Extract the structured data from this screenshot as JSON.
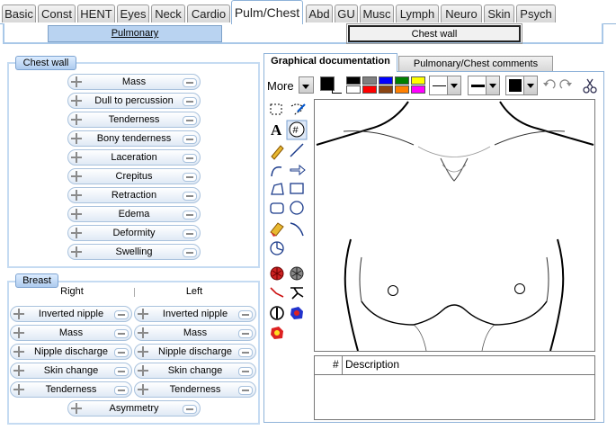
{
  "tabs": [
    "Basic",
    "Const",
    "HENT",
    "Eyes",
    "Neck",
    "Cardio",
    "Pulm/Chest",
    "Abd",
    "GU",
    "Musc",
    "Lymph",
    "Neuro",
    "Skin",
    "Psych"
  ],
  "subtabs": {
    "pulmonary": "Pulmonary",
    "chest_wall": "Chest wall"
  },
  "chest_wall": {
    "legend": "Chest wall",
    "items": [
      "Mass",
      "Dull to percussion",
      "Tenderness",
      "Bony tenderness",
      "Laceration",
      "Crepitus",
      "Retraction",
      "Edema",
      "Deformity",
      "Swelling"
    ]
  },
  "breast": {
    "legend": "Breast",
    "right_label": "Right",
    "left_label": "Left",
    "right_items": [
      "Inverted nipple",
      "Mass",
      "Nipple discharge",
      "Skin change",
      "Tenderness"
    ],
    "left_items": [
      "Inverted nipple",
      "Mass",
      "Nipple discharge",
      "Skin change",
      "Tenderness"
    ],
    "asymmetry": "Asymmetry"
  },
  "graphical": {
    "tab_active": "Graphical documentation",
    "tab_other": "Pulmonary/Chest comments",
    "more_label": "More",
    "palette_top": [
      "#000000",
      "#808080",
      "#0000ff",
      "#008000",
      "#ffff00"
    ],
    "palette_bottom": [
      "#ffffff",
      "#ff0000",
      "#8b4513",
      "#ff8000",
      "#ff00ff"
    ],
    "table_headers": {
      "num": "#",
      "desc": "Description"
    }
  }
}
